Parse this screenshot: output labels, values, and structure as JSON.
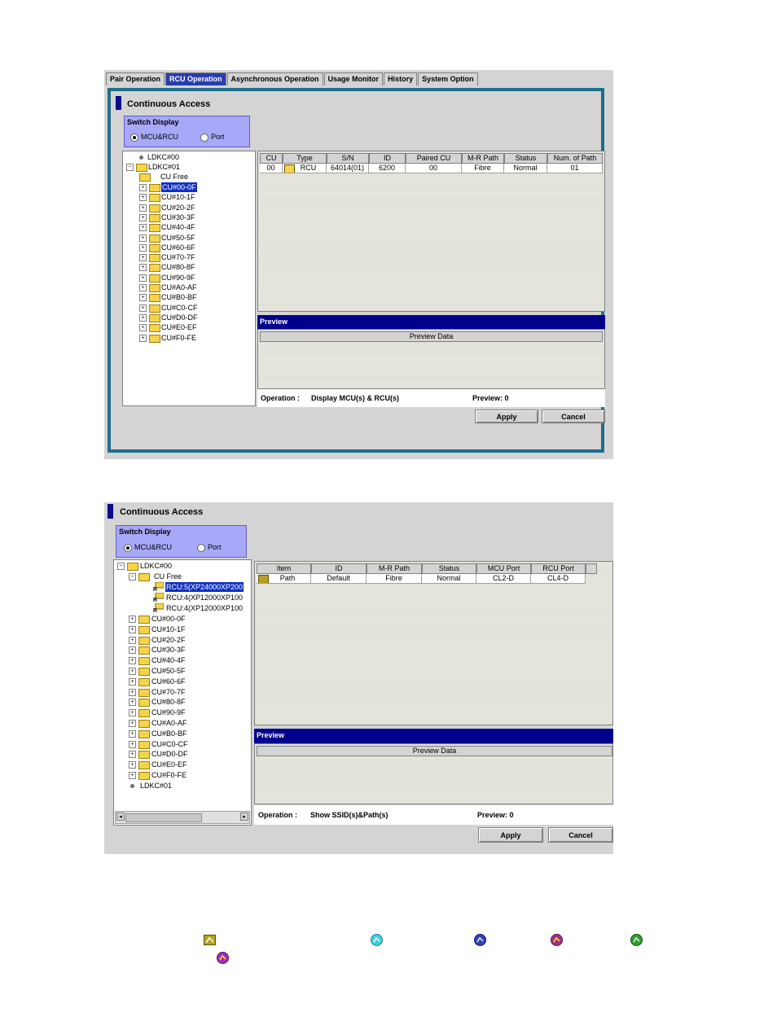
{
  "panel1": {
    "tabs": [
      "Pair Operation",
      "RCU Operation",
      "Asynchronous Operation",
      "Usage Monitor",
      "History",
      "System Option"
    ],
    "active_tab": "RCU Operation",
    "title": "Continuous Access",
    "switch_display": {
      "legend": "Switch Display",
      "option1": "MCU&RCU",
      "option2": "Port",
      "selected": "MCU&RCU"
    },
    "tree": {
      "ldkc00": "LDKC#00",
      "ldkc01": "LDKC#01",
      "cu_free": "CU Free",
      "cus": [
        "CU#00-0F",
        "CU#10-1F",
        "CU#20-2F",
        "CU#30-3F",
        "CU#40-4F",
        "CU#50-5F",
        "CU#60-6F",
        "CU#70-7F",
        "CU#80-8F",
        "CU#90-9F",
        "CU#A0-AF",
        "CU#B0-BF",
        "CU#C0-CF",
        "CU#D0-DF",
        "CU#E0-EF",
        "CU#F0-FE"
      ]
    },
    "table": {
      "headers": [
        "CU",
        "Type",
        "S/N",
        "ID",
        "Paired CU",
        "M-R Path",
        "Status",
        "Num. of Path"
      ],
      "rows": [
        [
          "00",
          "RCU",
          "64014(01)",
          "6200",
          "00",
          "Fibre",
          "Normal",
          "01"
        ]
      ]
    },
    "preview": {
      "title": "Preview",
      "data_label": "Preview Data"
    },
    "operation": {
      "label": "Operation :",
      "value": "Display MCU(s) & RCU(s)",
      "preview_count": "Preview: 0"
    },
    "buttons": {
      "apply": "Apply",
      "cancel": "Cancel"
    }
  },
  "panel2": {
    "title": "Continuous Access",
    "switch_display": {
      "legend": "Switch Display",
      "option1": "MCU&RCU",
      "option2": "Port",
      "selected": "MCU&RCU"
    },
    "tree": {
      "ldkc00": "LDKC#00",
      "cu_free": "CU Free",
      "rcus": [
        "RCU:5(XP24000XP200",
        "RCU:4(XP12000XP100",
        "RCU:4(XP12000XP100"
      ],
      "cus": [
        "CU#00-0F",
        "CU#10-1F",
        "CU#20-2F",
        "CU#30-3F",
        "CU#40-4F",
        "CU#50-5F",
        "CU#60-6F",
        "CU#70-7F",
        "CU#80-8F",
        "CU#90-9F",
        "CU#A0-AF",
        "CU#B0-BF",
        "CU#C0-CF",
        "CU#D0-DF",
        "CU#E0-EF",
        "CU#F0-FE"
      ],
      "ldkc01": "LDKC#01"
    },
    "table": {
      "headers": [
        "Item",
        "ID",
        "M-R Path",
        "Status",
        "MCU Port",
        "RCU Port"
      ],
      "rows": [
        [
          "Path",
          "Default",
          "Fibre",
          "Normal",
          "CL2-D",
          "CL4-D"
        ]
      ]
    },
    "preview": {
      "title": "Preview",
      "data_label": "Preview Data"
    },
    "operation": {
      "label": "Operation :",
      "value": "Show SSID(s)&Path(s)",
      "preview_count": "Preview: 0"
    },
    "buttons": {
      "apply": "Apply",
      "cancel": "Cancel"
    }
  },
  "legend_icons": {
    "colors": [
      "#b8a020",
      "#40d0e0",
      "#3040c0",
      "#a03090",
      "#30a030",
      "#a030c0"
    ]
  }
}
